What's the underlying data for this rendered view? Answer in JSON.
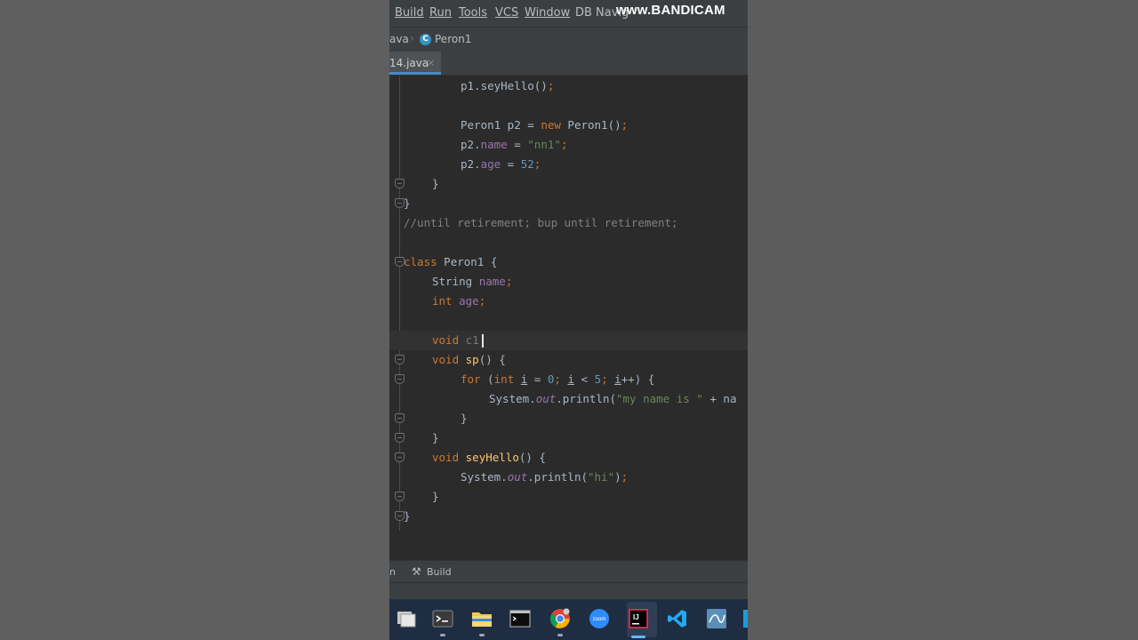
{
  "menubar": {
    "items": [
      "Build",
      "Run",
      "Tools",
      "VCS",
      "Window",
      "DB Navig"
    ],
    "watermark": "www.BANDICAM"
  },
  "navbar": {
    "crumb_partial": "ava",
    "class_icon_letter": "C",
    "crumb_class": "Peron1"
  },
  "tabs": {
    "active_label": "14.java",
    "close_glyph": "×"
  },
  "editor": {
    "lines": [
      "p1.seyHello();",
      "Peron1 p2 = new Peron1();",
      "p2.name = \"nn1\";",
      "p2.age = 52;",
      "}",
      "}",
      "//until retirement; bup until retirement;",
      "class Peron1 {",
      "String name;",
      "int age;",
      "void c1",
      "void sp() {",
      "for (int i = 0; i < 5; i++) {",
      "System.out.println(\"my name is \" + na",
      "}",
      "}",
      "void seyHello() {",
      "System.out.println(\"hi\");",
      "}",
      "}"
    ]
  },
  "bottom_tools": {
    "partial": "n",
    "build_label": "Build"
  },
  "taskbar": {
    "apps": [
      "file-manager",
      "terminal",
      "file-explorer",
      "command-prompt",
      "chrome",
      "zoom",
      "intellij-idea",
      "vscode",
      "mysql-workbench"
    ],
    "zoom_text": "zoom",
    "idea_text": "IJ"
  },
  "colors": {
    "keyword": "#cc7832",
    "field": "#9876aa",
    "string": "#6a8759",
    "number": "#6897bb",
    "comment": "#808080",
    "method": "#ffc66d",
    "text": "#a9b7c6",
    "background": "#2b2b2b"
  }
}
